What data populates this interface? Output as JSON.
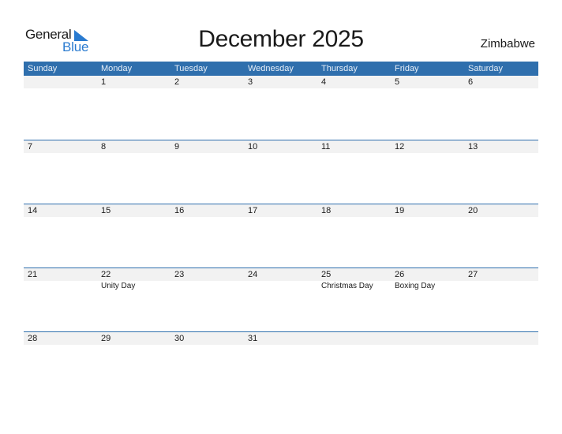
{
  "logo": {
    "word1": "General",
    "word2": "Blue",
    "accent": "#2a7bd0"
  },
  "title": "December 2025",
  "country": "Zimbabwe",
  "colors": {
    "header_bg": "#2f6fad",
    "band_bg": "#f2f2f2"
  },
  "weekdays": [
    "Sunday",
    "Monday",
    "Tuesday",
    "Wednesday",
    "Thursday",
    "Friday",
    "Saturday"
  ],
  "weeks": [
    [
      {
        "day": ""
      },
      {
        "day": "1"
      },
      {
        "day": "2"
      },
      {
        "day": "3"
      },
      {
        "day": "4"
      },
      {
        "day": "5"
      },
      {
        "day": "6"
      }
    ],
    [
      {
        "day": "7"
      },
      {
        "day": "8"
      },
      {
        "day": "9"
      },
      {
        "day": "10"
      },
      {
        "day": "11"
      },
      {
        "day": "12"
      },
      {
        "day": "13"
      }
    ],
    [
      {
        "day": "14"
      },
      {
        "day": "15"
      },
      {
        "day": "16"
      },
      {
        "day": "17"
      },
      {
        "day": "18"
      },
      {
        "day": "19"
      },
      {
        "day": "20"
      }
    ],
    [
      {
        "day": "21"
      },
      {
        "day": "22",
        "holiday": "Unity Day"
      },
      {
        "day": "23"
      },
      {
        "day": "24"
      },
      {
        "day": "25",
        "holiday": "Christmas Day"
      },
      {
        "day": "26",
        "holiday": "Boxing Day"
      },
      {
        "day": "27"
      }
    ],
    [
      {
        "day": "28"
      },
      {
        "day": "29"
      },
      {
        "day": "30"
      },
      {
        "day": "31"
      },
      {
        "day": ""
      },
      {
        "day": ""
      },
      {
        "day": ""
      }
    ]
  ]
}
